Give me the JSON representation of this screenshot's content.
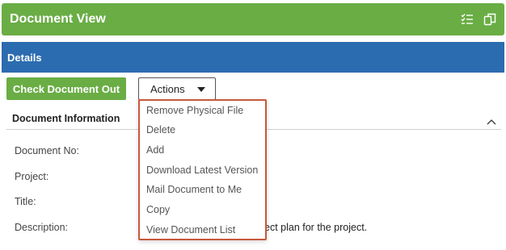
{
  "header": {
    "title": "Document View",
    "icons": [
      "checklist-icon",
      "copy-pages-icon"
    ]
  },
  "details_bar": {
    "label": "Details"
  },
  "toolbar": {
    "check_out_label": "Check Document Out",
    "actions_label": "Actions"
  },
  "actions_menu": {
    "items": [
      "Remove Physical File",
      "Delete",
      "Add",
      "Download Latest Version",
      "Mail Document to Me",
      "Copy",
      "View Document List"
    ]
  },
  "document_information": {
    "title": "Document Information",
    "fields": [
      {
        "label": "Document No:",
        "value": ""
      },
      {
        "label": "Project:",
        "value": ""
      },
      {
        "label": "Title:",
        "value": ""
      },
      {
        "label": "Description:",
        "value": "ect plan for the project."
      }
    ]
  },
  "colors": {
    "header_green": "#6aad45",
    "details_blue": "#2b6cb0",
    "menu_border": "#c7583a"
  }
}
